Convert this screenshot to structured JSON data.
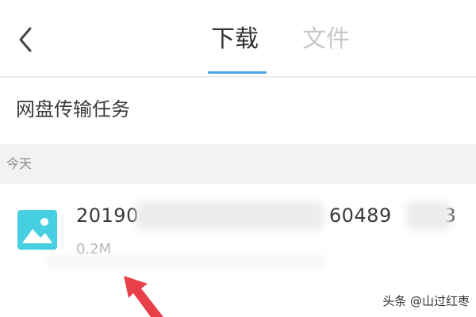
{
  "header": {
    "tabs": [
      {
        "label": "下载",
        "active": true
      },
      {
        "label": "文件",
        "active": false
      }
    ]
  },
  "section": {
    "title": "网盘传输任务"
  },
  "group": {
    "date_label": "今天"
  },
  "file": {
    "name_prefix": "20190",
    "name_mid": "60489",
    "name_suffix": "23",
    "size": "0.2M",
    "icon": "image-file-icon"
  },
  "watermark": "头条 @山过红枣",
  "colors": {
    "accent": "#4aa3e0",
    "file_icon": "#46cfe0",
    "annotation_arrow": "#e8404a"
  }
}
